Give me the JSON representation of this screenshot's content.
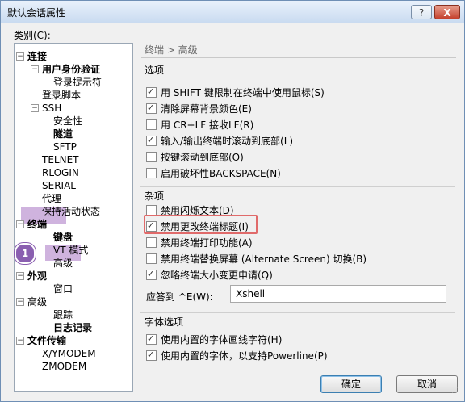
{
  "window": {
    "title": "默认会话属性",
    "help_label": "?",
    "close_label": "X"
  },
  "category_label": "类别(C):",
  "tree": [
    {
      "label": "连接",
      "bold": true,
      "exp": "−"
    },
    {
      "label": "用户身份验证",
      "bold": true,
      "exp": "−"
    },
    {
      "label": "登录提示符",
      "bold": false
    },
    {
      "label": "登录脚本",
      "bold": false
    },
    {
      "label": "SSH",
      "bold": false,
      "exp": "−"
    },
    {
      "label": "安全性",
      "bold": false
    },
    {
      "label": "隧道",
      "bold": true
    },
    {
      "label": "SFTP",
      "bold": false
    },
    {
      "label": "TELNET",
      "bold": false
    },
    {
      "label": "RLOGIN",
      "bold": false
    },
    {
      "label": "SERIAL",
      "bold": false
    },
    {
      "label": "代理",
      "bold": false
    },
    {
      "label": "保持活动状态",
      "bold": false
    },
    {
      "label": "终端",
      "bold": true,
      "exp": "−",
      "selected": true
    },
    {
      "label": "键盘",
      "bold": true
    },
    {
      "label": "VT 模式",
      "bold": false
    },
    {
      "label": "高级",
      "bold": false,
      "selected": true
    },
    {
      "label": "外观",
      "bold": true,
      "exp": "−"
    },
    {
      "label": "窗口",
      "bold": false
    },
    {
      "label": "高级",
      "bold": false,
      "exp": "−"
    },
    {
      "label": "跟踪",
      "bold": false
    },
    {
      "label": "日志记录",
      "bold": true
    },
    {
      "label": "文件传输",
      "bold": true,
      "exp": "−"
    },
    {
      "label": "X/YMODEM",
      "bold": false
    },
    {
      "label": "ZMODEM",
      "bold": false
    }
  ],
  "annotation_badge": "1",
  "breadcrumb": "终端 > 高级",
  "options": {
    "title": "选项",
    "items": [
      {
        "label": "用 SHIFT 键限制在终端中使用鼠标(S)",
        "checked": true
      },
      {
        "label": "清除屏幕背景颜色(E)",
        "checked": true
      },
      {
        "label": "用 CR+LF 接收LF(R)",
        "checked": false
      },
      {
        "label": "输入/输出终端时滚动到底部(L)",
        "checked": true
      },
      {
        "label": "按键滚动到底部(O)",
        "checked": false
      },
      {
        "label": "启用破坏性BACKSPACE(N)",
        "checked": false
      }
    ]
  },
  "misc": {
    "title": "杂项",
    "items": [
      {
        "label": "禁用闪烁文本(D)",
        "checked": false
      },
      {
        "label": "禁用更改终端标题(I)",
        "checked": true
      },
      {
        "label": "禁用终端打印功能(A)",
        "checked": false
      },
      {
        "label": "禁用终端替换屏幕 (Alternate Screen) 切换(B)",
        "checked": false
      },
      {
        "label": "忽略终端大小变更申请(Q)",
        "checked": true
      }
    ],
    "answerback_label": "应答到 ^E(W):",
    "answerback_value": "Xshell"
  },
  "font_options": {
    "title": "字体选项",
    "items": [
      {
        "label": "使用内置的字体画线字符(H)",
        "checked": true
      },
      {
        "label": "使用内置的字体，以支持Powerline(P)",
        "checked": true
      }
    ]
  },
  "buttons": {
    "ok": "确定",
    "cancel": "取消"
  }
}
